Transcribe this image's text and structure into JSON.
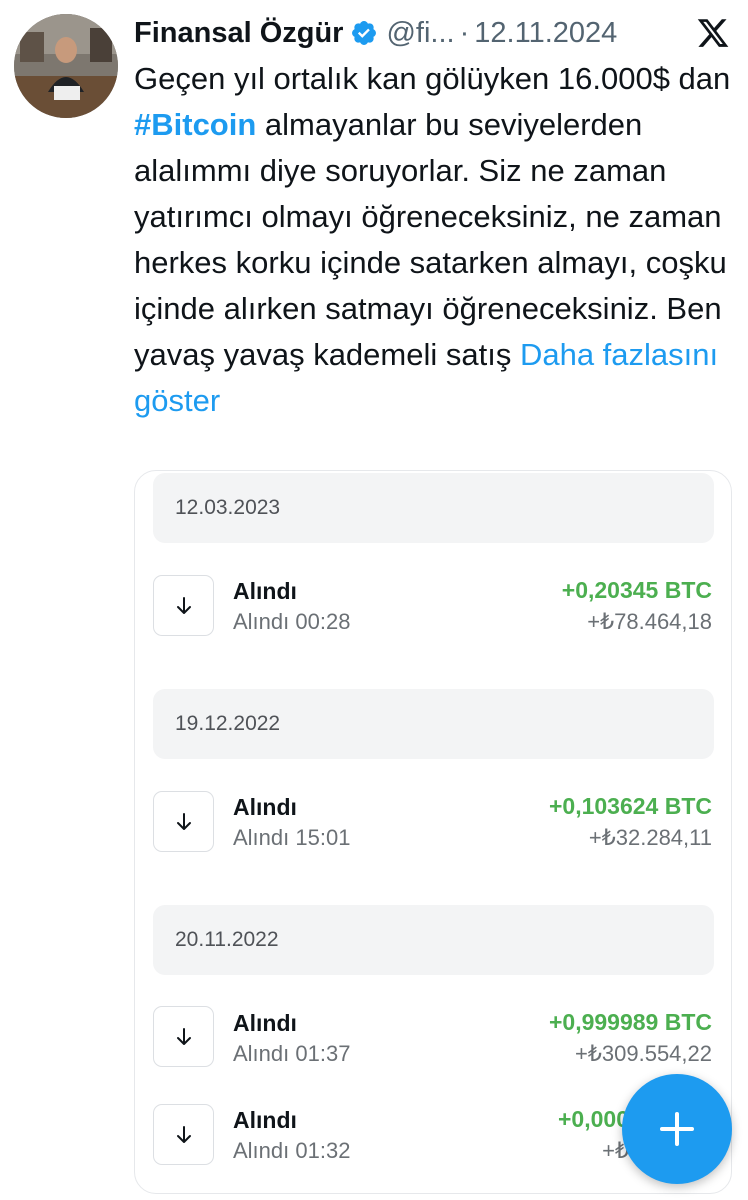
{
  "tweet": {
    "author_name": "Finansal Özgür",
    "handle": "@fi...",
    "separator": "·",
    "date": "12.11.2024",
    "text_before": "Geçen yıl ortalık kan gölüyken 16.000$ dan ",
    "hashtag": "#Bitcoin",
    "text_after": " almayanlar bu seviyelerden alalımmı diye soruyorlar. Siz ne zaman yatırımcı olmayı öğreneceksiniz, ne zaman herkes korku içinde satarken almayı, coşku içinde alırken satmayı öğreneceksiniz. Ben yavaş yavaş kademeli satış ",
    "show_more": "Daha fazlasını göster"
  },
  "media": {
    "groups": [
      {
        "date": "12.03.2023",
        "transactions": [
          {
            "title": "Alındı",
            "subtitle": "Alındı 00:28",
            "amount": "+0,20345 BTC",
            "fiat": "+₺78.464,18"
          }
        ]
      },
      {
        "date": "19.12.2022",
        "transactions": [
          {
            "title": "Alındı",
            "subtitle": "Alındı 15:01",
            "amount": "+0,103624 BTC",
            "fiat": "+₺32.284,11"
          }
        ]
      },
      {
        "date": "20.11.2022",
        "transactions": [
          {
            "title": "Alındı",
            "subtitle": "Alındı 01:37",
            "amount": "+0,999989 BTC",
            "fiat": "+₺309.554,22"
          },
          {
            "title": "Alındı",
            "subtitle": "Alındı 01:32",
            "amount": "+0,000",
            "fiat": "+₺"
          }
        ]
      }
    ]
  },
  "icons": {
    "verified": "verified-badge-icon",
    "platform": "x-logo-icon",
    "transaction": "arrow-down-icon",
    "compose": "plus-icon"
  },
  "colors": {
    "link": "#1d9bf0",
    "amount_positive": "#4caf50",
    "fab": "#1d9bf0"
  }
}
